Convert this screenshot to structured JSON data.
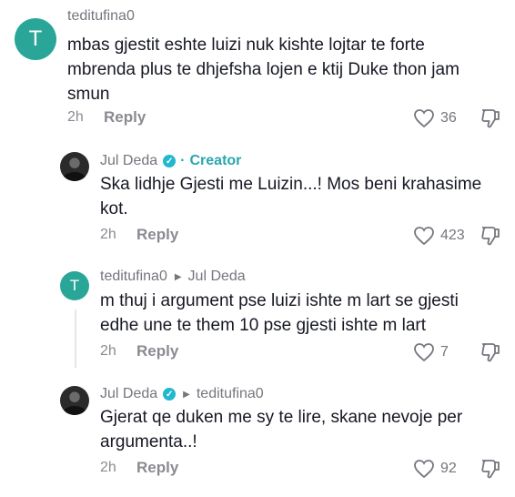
{
  "comments": [
    {
      "username": "tedituﬁna0",
      "avatar_letter": "T",
      "text": "mbas gjestit eshte luizi nuk kishte lojtar te forte\nmbrenda plus te dhjefsha lojen e ktij Duke thon jam\nsmun",
      "time": "2h",
      "reply_label": "Reply",
      "likes": "36"
    },
    {
      "username": "Jul Deda",
      "verified": "✓",
      "creator_label": "Creator",
      "text": "Ska lidhje Gjesti me Luizin...! Mos beni krahasime\nkot.",
      "time": "2h",
      "reply_label": "Reply",
      "likes": "423"
    },
    {
      "username": "tedituﬁna0",
      "avatar_letter": "T",
      "reply_to": "Jul Deda",
      "text": "m thuj i argument pse luizi ishte m lart se gjesti\nedhe une te them 10 pse gjesti ishte m lart",
      "time": "2h",
      "reply_label": "Reply",
      "likes": "7"
    },
    {
      "username": "Jul Deda",
      "verified": "✓",
      "reply_to": "tedituﬁna0",
      "text": "Gjerat qe duken me sy te lire, skane nevoje per\nargumenta..!",
      "time": "2h",
      "reply_label": "Reply",
      "likes": "92"
    }
  ],
  "icons": {
    "like": "heart-outline-icon",
    "dislike": "thumbs-down-outline-icon",
    "verified": "verified-badge-icon",
    "arrow": "reply-arrow-icon"
  },
  "colors": {
    "avatar_t": "#2aa698",
    "creator": "#2aa6b0",
    "verified": "#20b8cf",
    "text": "#161823",
    "muted": "#8a8b91"
  }
}
